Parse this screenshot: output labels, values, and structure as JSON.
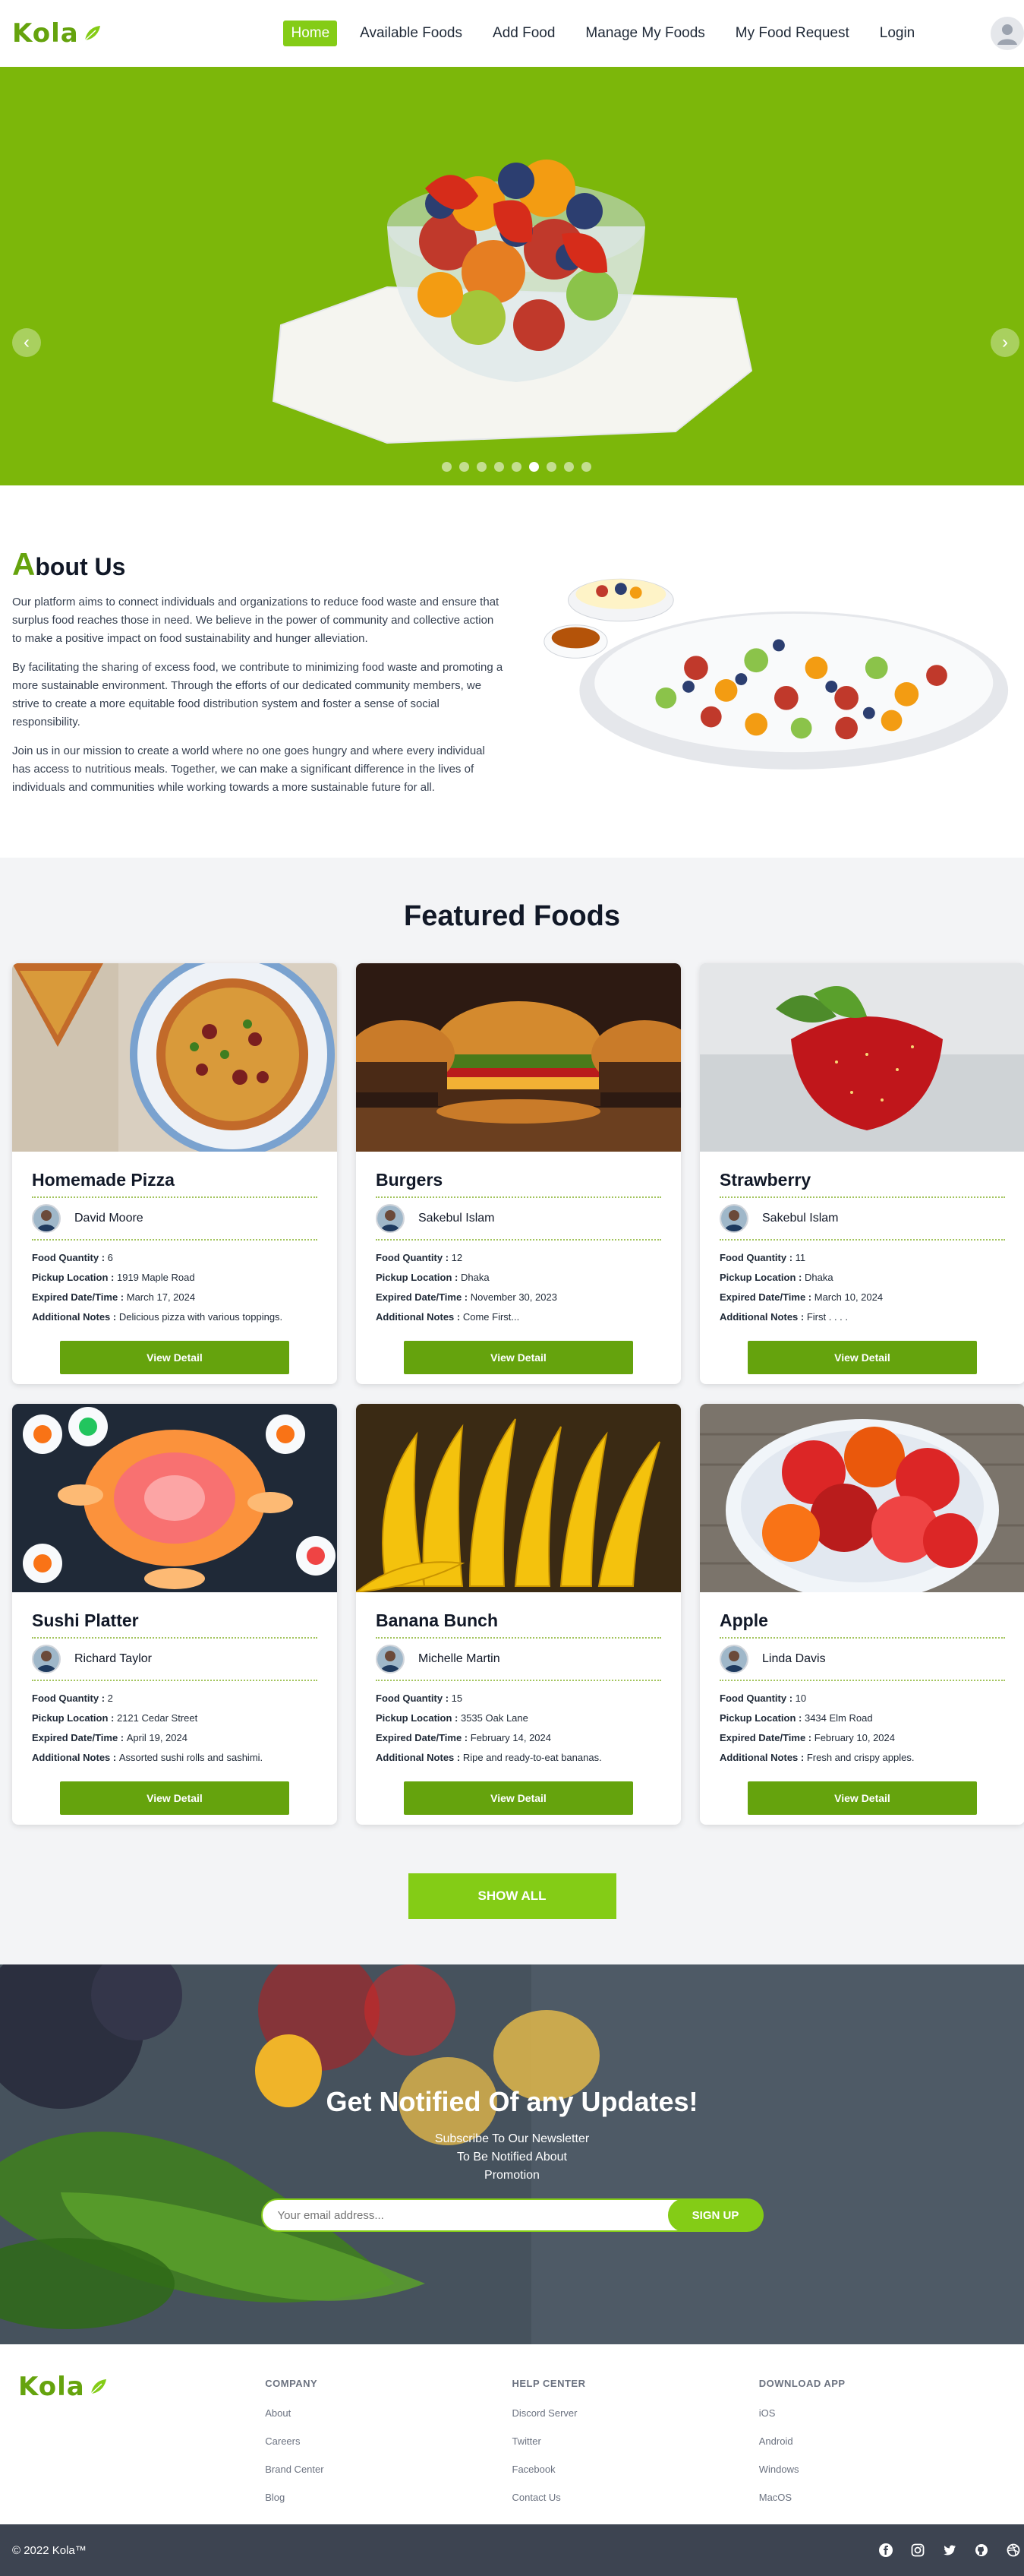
{
  "nav": {
    "logo": "Kola",
    "items": [
      {
        "label": "Home",
        "active": true
      },
      {
        "label": "Available Foods"
      },
      {
        "label": "Add Food"
      },
      {
        "label": "Manage My Foods"
      },
      {
        "label": "My Food Request"
      },
      {
        "label": "Login"
      }
    ],
    "avatar_icon": "user-avatar-icon"
  },
  "hero": {
    "background": "#7cb70a",
    "slide_count": 9,
    "active_slide": 6,
    "left_arrow": "‹",
    "right_arrow": "›"
  },
  "about": {
    "title_first": "A",
    "title_rest": "bout Us",
    "paragraphs": [
      "Our platform aims to connect individuals and organizations to reduce food waste and ensure that surplus food reaches those in need. We believe in the power of community and collective action to make a positive impact on food sustainability and hunger alleviation.",
      "By facilitating the sharing of excess food, we contribute to minimizing food waste and promoting a more sustainable environment. Through the efforts of our dedicated community members, we strive to create a more equitable food distribution system and foster a sense of social responsibility.",
      "Join us in our mission to create a world where no one goes hungry and where every individual has access to nutritious meals. Together, we can make a significant difference in the lives of individuals and communities while working towards a more sustainable future for all."
    ]
  },
  "featured": {
    "title": "Featured Foods",
    "labels": {
      "quantity": "Food Quantity : ",
      "location": "Pickup Location : ",
      "expired": "Expired Date/Time : ",
      "notes": "Additional Notes : "
    },
    "button_label": "View Detail",
    "foods": [
      {
        "name": "Homemade Pizza",
        "donor": "David Moore",
        "quantity": "6",
        "location": "1919 Maple Road",
        "expired": "March 17, 2024",
        "notes": "Delicious pizza with various toppings."
      },
      {
        "name": "Burgers",
        "donor": "Sakebul Islam",
        "quantity": "12",
        "location": "Dhaka",
        "expired": "November 30, 2023",
        "notes": "Come First..."
      },
      {
        "name": "Strawberry",
        "donor": "Sakebul Islam",
        "quantity": "11",
        "location": "Dhaka",
        "expired": "March 10, 2024",
        "notes": "First . . . ."
      },
      {
        "name": "Sushi Platter",
        "donor": "Richard Taylor",
        "quantity": "2",
        "location": "2121 Cedar Street",
        "expired": "April 19, 2024",
        "notes": "Assorted sushi rolls and sashimi."
      },
      {
        "name": "Banana Bunch",
        "donor": "Michelle Martin",
        "quantity": "15",
        "location": "3535 Oak Lane",
        "expired": "February 14, 2024",
        "notes": "Ripe and ready-to-eat bananas."
      },
      {
        "name": "Apple",
        "donor": "Linda Davis",
        "quantity": "10",
        "location": "3434 Elm Road",
        "expired": "February 10, 2024",
        "notes": "Fresh and crispy apples."
      }
    ],
    "show_all": "SHOW ALL"
  },
  "newsletter": {
    "title": "Get Notified Of any Updates!",
    "subtitle": "Subscribe To Our Newsletter To Be Notified About Promotion",
    "placeholder": "Your email address...",
    "button": "SIGN UP"
  },
  "footer": {
    "logo": "Kola",
    "columns": [
      {
        "heading": "COMPANY",
        "links": [
          "About",
          "Careers",
          "Brand Center",
          "Blog"
        ]
      },
      {
        "heading": "HELP CENTER",
        "links": [
          "Discord Server",
          "Twitter",
          "Facebook",
          "Contact Us"
        ]
      },
      {
        "heading": "DOWNLOAD APP",
        "links": [
          "iOS",
          "Android",
          "Windows",
          "MacOS"
        ]
      }
    ],
    "copyright": "© 2022 Kola™",
    "socials": [
      "facebook-icon",
      "instagram-icon",
      "twitter-icon",
      "github-icon",
      "dribbble-icon"
    ]
  },
  "colors": {
    "brand_green": "#84cc16",
    "dark_green": "#65a30d",
    "footer_bar": "#3d4451"
  }
}
